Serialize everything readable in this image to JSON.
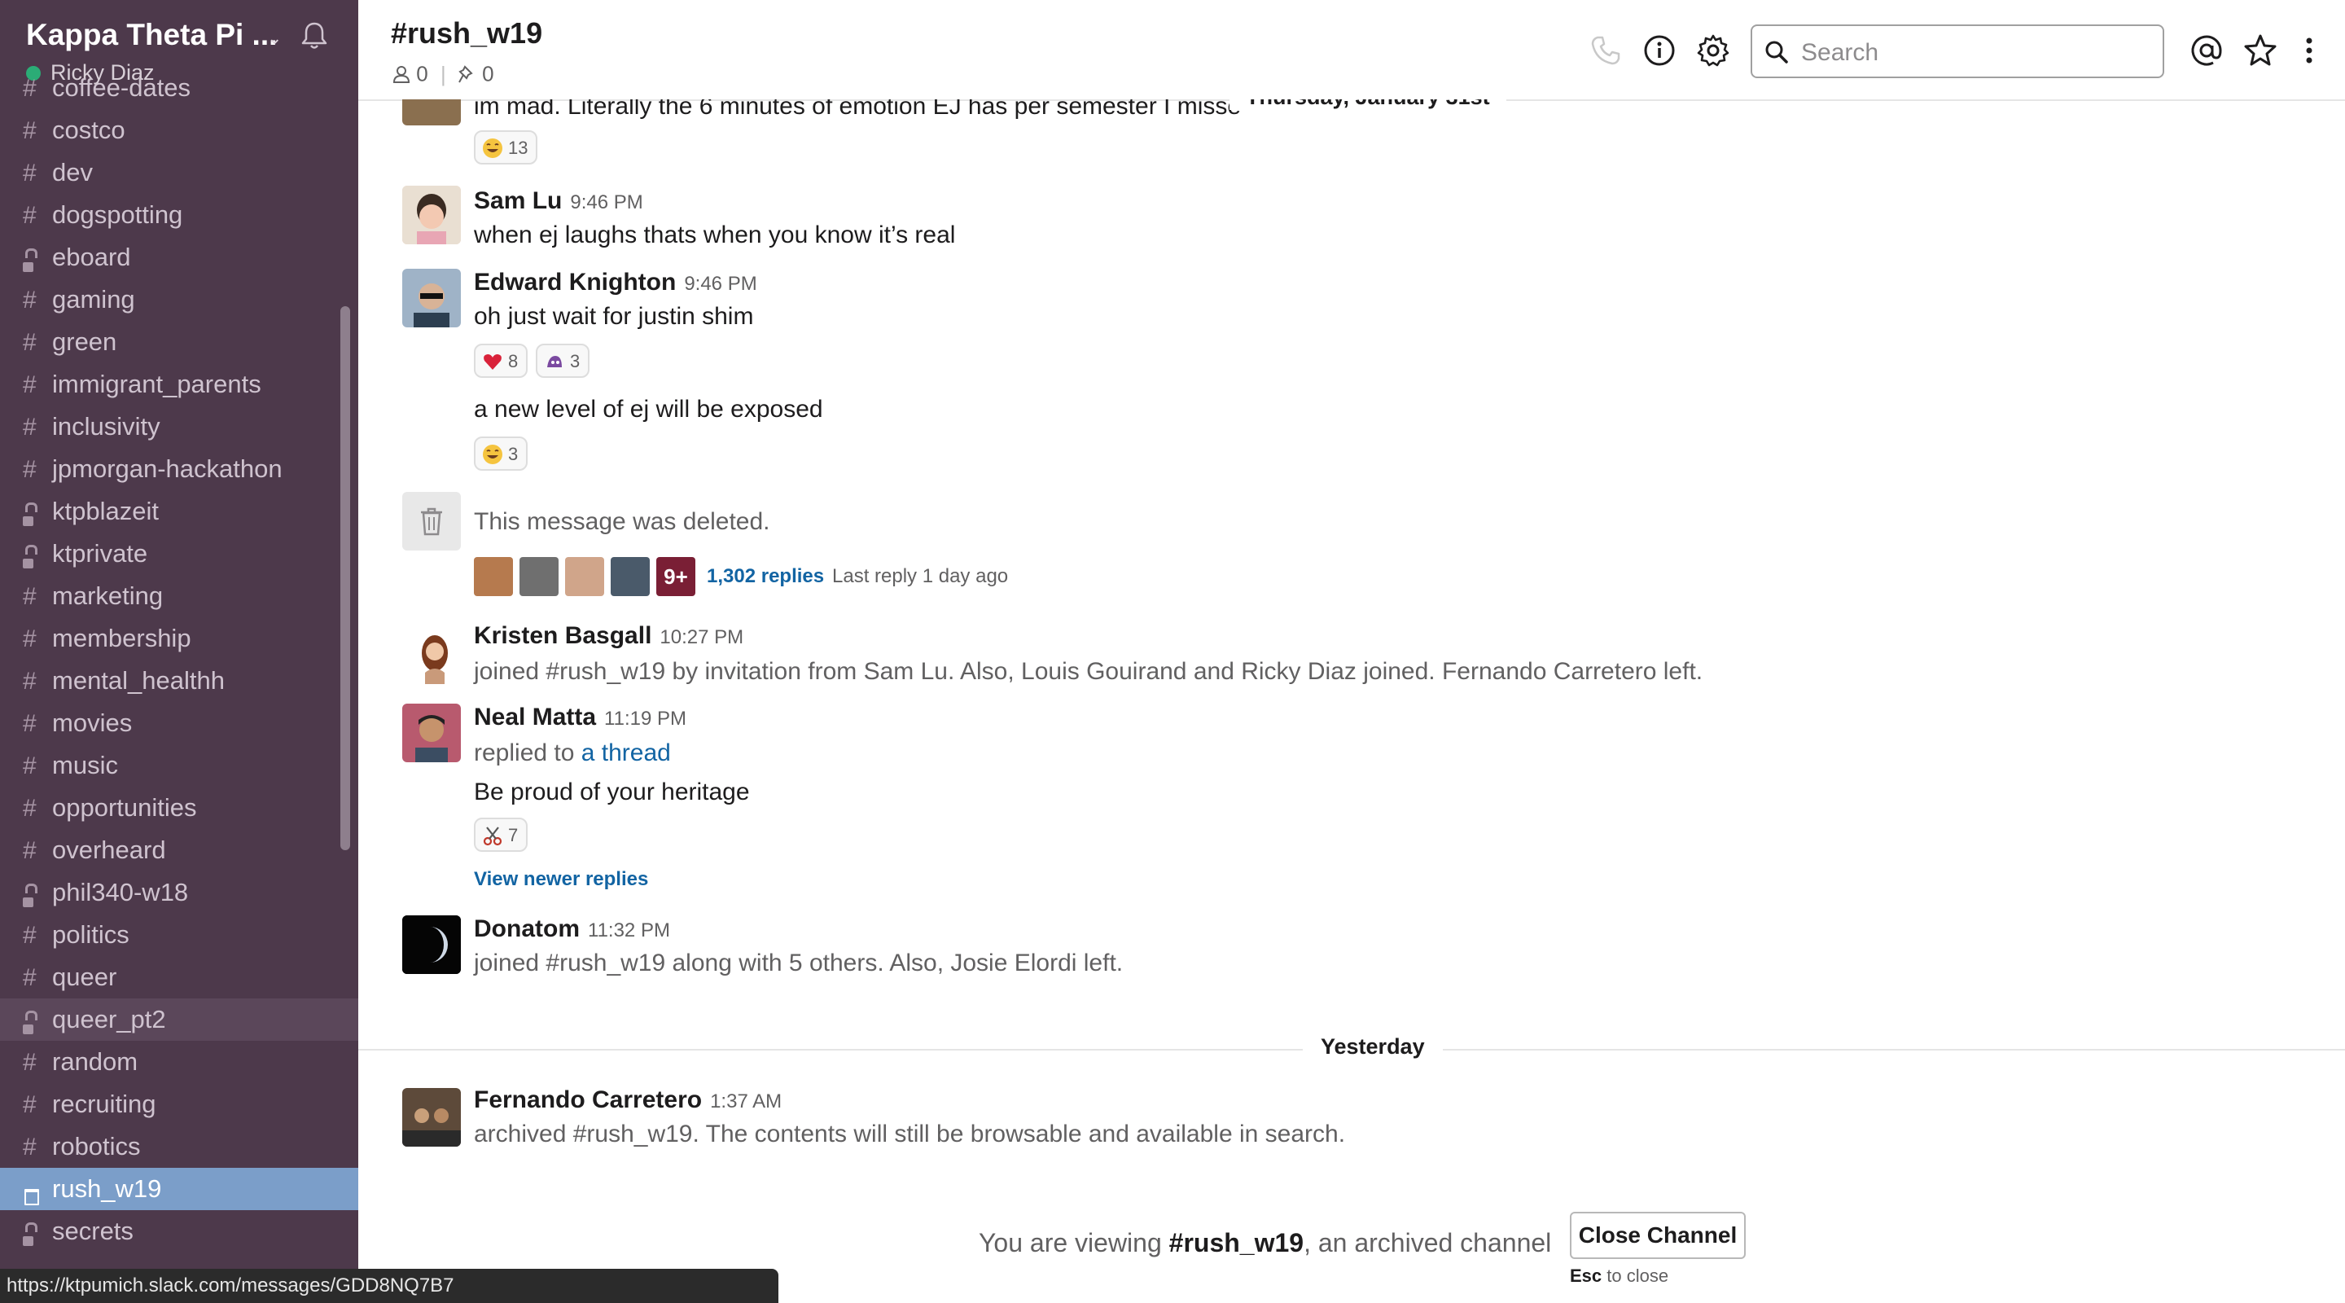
{
  "workspace": {
    "team_name": "Kappa Theta Pi ...",
    "user_name": "Ricky Diaz",
    "status_url": "https://ktpumich.slack.com/messages/GDD8NQ7B7"
  },
  "sidebar": {
    "channels": [
      {
        "name": "coffee-dates",
        "type": "public"
      },
      {
        "name": "costco",
        "type": "public"
      },
      {
        "name": "dev",
        "type": "public"
      },
      {
        "name": "dogspotting",
        "type": "public"
      },
      {
        "name": "eboard",
        "type": "private"
      },
      {
        "name": "gaming",
        "type": "public"
      },
      {
        "name": "green",
        "type": "public"
      },
      {
        "name": "immigrant_parents",
        "type": "public"
      },
      {
        "name": "inclusivity",
        "type": "public"
      },
      {
        "name": "jpmorgan-hackathon",
        "type": "public"
      },
      {
        "name": "ktpblazeit",
        "type": "private"
      },
      {
        "name": "ktprivate",
        "type": "private"
      },
      {
        "name": "marketing",
        "type": "public"
      },
      {
        "name": "membership",
        "type": "public"
      },
      {
        "name": "mental_healthh",
        "type": "public"
      },
      {
        "name": "movies",
        "type": "public"
      },
      {
        "name": "music",
        "type": "public"
      },
      {
        "name": "opportunities",
        "type": "public"
      },
      {
        "name": "overheard",
        "type": "public"
      },
      {
        "name": "phil340-w18",
        "type": "private"
      },
      {
        "name": "politics",
        "type": "public"
      },
      {
        "name": "queer",
        "type": "public"
      },
      {
        "name": "queer_pt2",
        "type": "private"
      },
      {
        "name": "random",
        "type": "public"
      },
      {
        "name": "recruiting",
        "type": "public"
      },
      {
        "name": "robotics",
        "type": "public"
      },
      {
        "name": "rush_w19",
        "type": "archived"
      },
      {
        "name": "secrets",
        "type": "private"
      }
    ],
    "active_channel": "rush_w19",
    "hovered_channel": "queer_pt2"
  },
  "header": {
    "channel_title": "#rush_w19",
    "member_count": "0",
    "pinned_count": "0",
    "search_placeholder": "Search"
  },
  "messages": {
    "top_partial": {
      "text": "im mad. Literally the 6 minutes of emotion EJ has per semester I misse",
      "reaction": {
        "emoji": "joy",
        "count": "13"
      }
    },
    "date_thursday": "Thursday, January 31st",
    "sam": {
      "name": "Sam Lu",
      "time": "9:46 PM",
      "text": "when ej laughs thats when you know it’s real"
    },
    "edward": {
      "name": "Edward Knighton",
      "time": "9:46 PM",
      "text1": "oh just wait for justin shim",
      "reactions1": [
        {
          "emoji": "heart",
          "count": "8"
        },
        {
          "emoji": "custom",
          "count": "3"
        }
      ],
      "text2": "a new level of ej will be exposed",
      "reactions2": [
        {
          "emoji": "joy",
          "count": "3"
        }
      ]
    },
    "deleted": {
      "text": "This message was deleted.",
      "more_badge": "9+",
      "replies": "1,302 replies",
      "last_reply": "Last reply 1 day ago"
    },
    "kristen": {
      "name": "Kristen Basgall",
      "time": "10:27 PM",
      "text": "joined #rush_w19 by invitation from Sam Lu. Also, Louis Gouirand and Ricky Diaz joined. Fernando Carretero left."
    },
    "neal": {
      "name": "Neal Matta",
      "time": "11:19 PM",
      "replied_to": "replied to",
      "thread_link": "a thread",
      "text": "Be proud of your heritage",
      "reaction": {
        "emoji": "scissors",
        "count": "7"
      },
      "view_newer": "View newer replies"
    },
    "donatom": {
      "name": "Donatom",
      "time": "11:32 PM",
      "text": "joined #rush_w19 along with 5 others. Also, Josie Elordi left."
    },
    "date_yesterday": "Yesterday",
    "fernando": {
      "name": "Fernando Carretero",
      "time": "1:37 AM",
      "text": "archived #rush_w19. The contents will still be browsable and available in search."
    }
  },
  "archived_bar": {
    "prefix": "You are viewing",
    "channel": "#rush_w19",
    "suffix": ", an archived channel",
    "close_label": "Close Channel",
    "esc_key": "Esc",
    "esc_suffix": "to close"
  }
}
